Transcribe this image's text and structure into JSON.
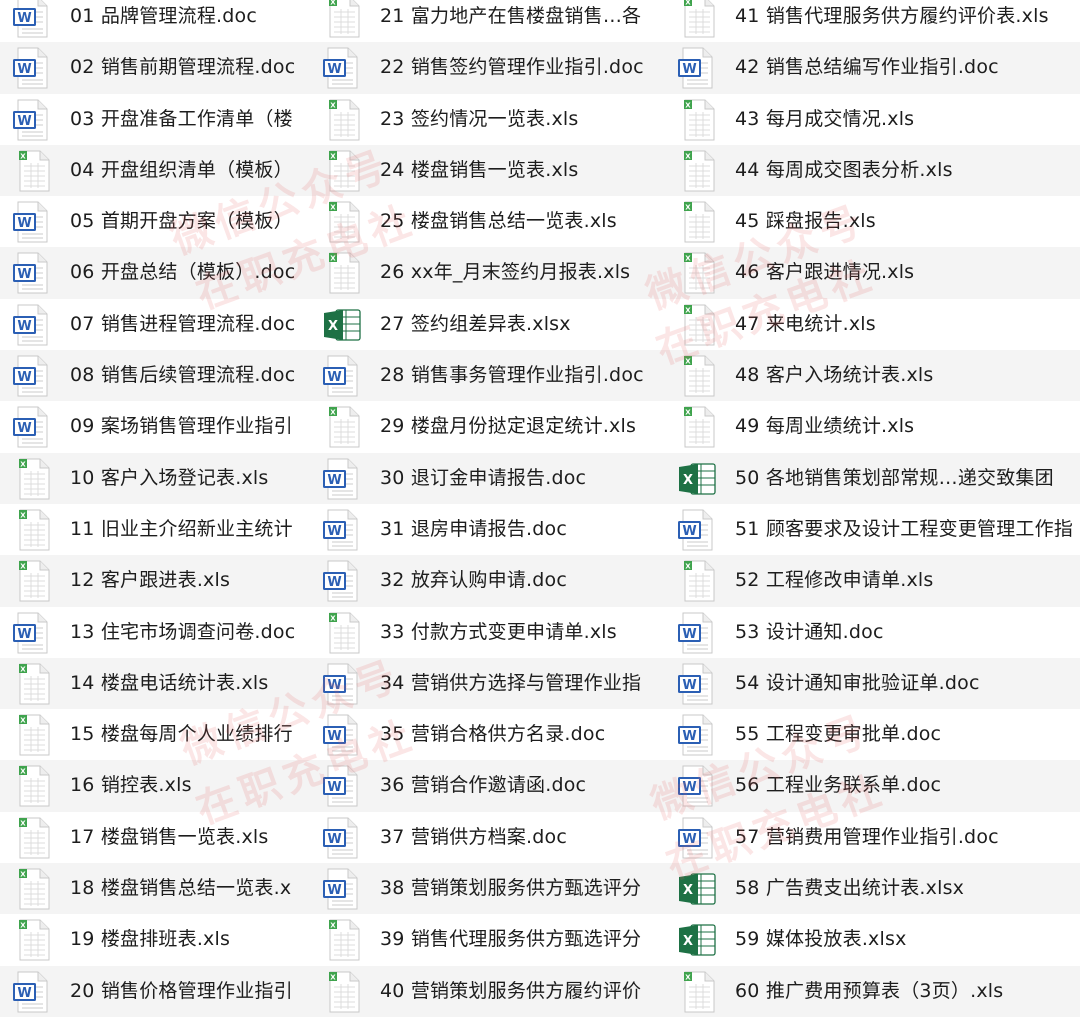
{
  "files": [
    {
      "name": "01 品牌管理流程.doc",
      "icon": "word-doc-icon"
    },
    {
      "name": "02 销售前期管理流程.doc",
      "icon": "word-doc-icon"
    },
    {
      "name": "03 开盘准备工作清单（楼",
      "icon": "word-doc-icon"
    },
    {
      "name": "04 开盘组织清单（模板）",
      "icon": "xls-sheet-icon"
    },
    {
      "name": "05 首期开盘方案（模板）",
      "icon": "word-doc-icon"
    },
    {
      "name": "06 开盘总结（模板）.doc",
      "icon": "word-doc-icon"
    },
    {
      "name": "07 销售进程管理流程.doc",
      "icon": "word-doc-icon"
    },
    {
      "name": "08 销售后续管理流程.doc",
      "icon": "word-doc-icon"
    },
    {
      "name": "09 案场销售管理作业指引",
      "icon": "word-doc-icon"
    },
    {
      "name": "10 客户入场登记表.xls",
      "icon": "xls-sheet-icon"
    },
    {
      "name": "11 旧业主介绍新业主统计",
      "icon": "xls-sheet-icon"
    },
    {
      "name": "12 客户跟进表.xls",
      "icon": "xls-sheet-icon"
    },
    {
      "name": "13 住宅市场调查问卷.doc",
      "icon": "word-doc-icon"
    },
    {
      "name": "14 楼盘电话统计表.xls",
      "icon": "xls-sheet-icon"
    },
    {
      "name": "15 楼盘每周个人业绩排行",
      "icon": "xls-sheet-icon"
    },
    {
      "name": "16 销控表.xls",
      "icon": "xls-sheet-icon"
    },
    {
      "name": "17 楼盘销售一览表.xls",
      "icon": "xls-sheet-icon"
    },
    {
      "name": "18 楼盘销售总结一览表.x",
      "icon": "xls-sheet-icon"
    },
    {
      "name": "19 楼盘排班表.xls",
      "icon": "xls-sheet-icon"
    },
    {
      "name": "20 销售价格管理作业指引",
      "icon": "word-doc-icon"
    },
    {
      "name": "21 富力地产在售楼盘销售…各",
      "icon": "xls-sheet-icon"
    },
    {
      "name": "22 销售签约管理作业指引.doc",
      "icon": "word-doc-icon"
    },
    {
      "name": "23 签约情况一览表.xls",
      "icon": "xls-sheet-icon"
    },
    {
      "name": "24 楼盘销售一览表.xls",
      "icon": "xls-sheet-icon"
    },
    {
      "name": "25 楼盘销售总结一览表.xls",
      "icon": "xls-sheet-icon"
    },
    {
      "name": "26 xx年_月末签约月报表.xls",
      "icon": "xls-sheet-icon"
    },
    {
      "name": "27 签约组差异表.xlsx",
      "icon": "excel-x-icon"
    },
    {
      "name": "28 销售事务管理作业指引.doc",
      "icon": "word-doc-icon"
    },
    {
      "name": "29 楼盘月份挞定退定统计.xls",
      "icon": "xls-sheet-icon"
    },
    {
      "name": "30 退订金申请报告.doc",
      "icon": "word-doc-icon"
    },
    {
      "name": "31 退房申请报告.doc",
      "icon": "word-doc-icon"
    },
    {
      "name": "32 放弃认购申请.doc",
      "icon": "word-doc-icon"
    },
    {
      "name": "33 付款方式变更申请单.xls",
      "icon": "xls-sheet-icon"
    },
    {
      "name": "34 营销供方选择与管理作业指",
      "icon": "word-doc-icon"
    },
    {
      "name": "35 营销合格供方名录.doc",
      "icon": "word-doc-icon"
    },
    {
      "name": "36 营销合作邀请函.doc",
      "icon": "word-doc-icon"
    },
    {
      "name": "37 营销供方档案.doc",
      "icon": "word-doc-icon"
    },
    {
      "name": "38 营销策划服务供方甄选评分",
      "icon": "word-doc-icon"
    },
    {
      "name": "39 销售代理服务供方甄选评分",
      "icon": "xls-sheet-icon"
    },
    {
      "name": "40 营销策划服务供方履约评价",
      "icon": "xls-sheet-icon"
    },
    {
      "name": "41 销售代理服务供方履约评价表.xls",
      "icon": "xls-sheet-icon"
    },
    {
      "name": "42 销售总结编写作业指引.doc",
      "icon": "word-doc-icon"
    },
    {
      "name": "43 每月成交情况.xls",
      "icon": "xls-sheet-icon"
    },
    {
      "name": "44 每周成交图表分析.xls",
      "icon": "xls-sheet-icon"
    },
    {
      "name": "45 踩盘报告.xls",
      "icon": "xls-sheet-icon"
    },
    {
      "name": "46 客户跟进情况.xls",
      "icon": "xls-sheet-icon"
    },
    {
      "name": "47 来电统计.xls",
      "icon": "xls-sheet-icon"
    },
    {
      "name": "48 客户入场统计表.xls",
      "icon": "xls-sheet-icon"
    },
    {
      "name": "49 每周业绩统计.xls",
      "icon": "xls-sheet-icon"
    },
    {
      "name": "50 各地销售策划部常规…递交致集团",
      "icon": "excel-x-icon"
    },
    {
      "name": "51 顾客要求及设计工程变更管理工作指",
      "icon": "word-doc-icon"
    },
    {
      "name": "52 工程修改申请单.xls",
      "icon": "xls-sheet-icon"
    },
    {
      "name": "53 设计通知.doc",
      "icon": "word-doc-icon"
    },
    {
      "name": "54 设计通知审批验证单.doc",
      "icon": "word-doc-icon"
    },
    {
      "name": "55 工程变更审批单.doc",
      "icon": "word-doc-icon"
    },
    {
      "name": "56 工程业务联系单.doc",
      "icon": "word-doc-icon"
    },
    {
      "name": "57 营销费用管理作业指引.doc",
      "icon": "word-doc-icon"
    },
    {
      "name": "58 广告费支出统计表.xlsx",
      "icon": "excel-x-icon"
    },
    {
      "name": "59 媒体投放表.xlsx",
      "icon": "excel-x-icon"
    },
    {
      "name": "60 推广费用预算表（3页）.xls",
      "icon": "xls-sheet-icon"
    }
  ],
  "watermarks": [
    "微信公众号",
    "在职充电社"
  ],
  "colors": {
    "word": "#2b5fb4",
    "excel": "#1e7145",
    "sheet_tab": "#3fa34d"
  }
}
